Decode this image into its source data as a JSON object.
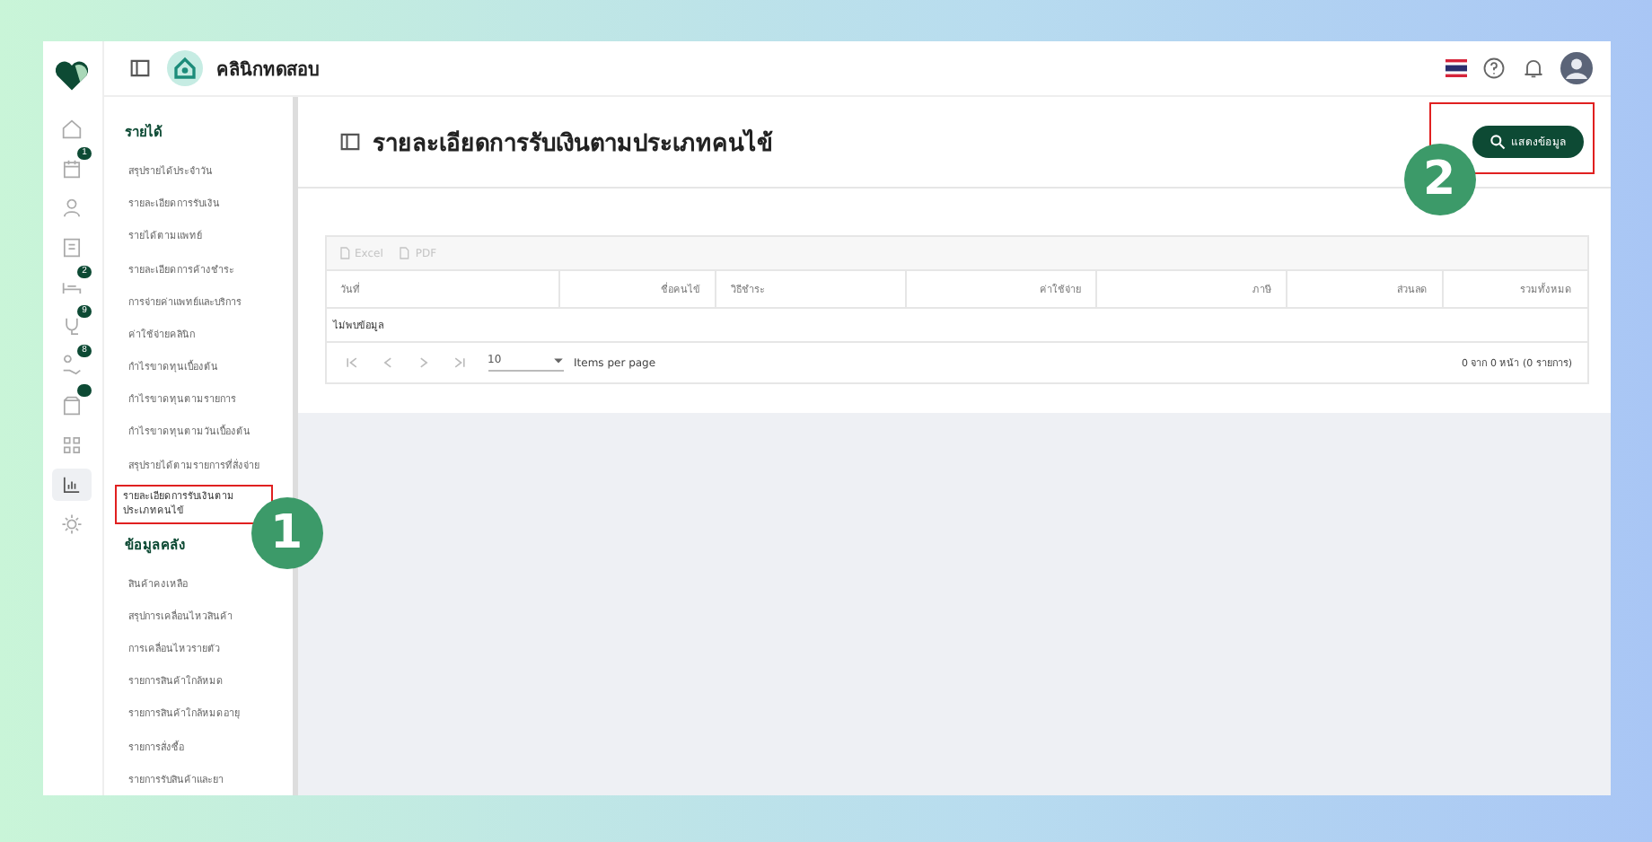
{
  "header": {
    "clinic_name": "คลินิกทดสอบ"
  },
  "rail": [
    {
      "selected": false
    },
    {
      "badge": "1",
      "selected": false
    },
    {
      "selected": false
    },
    {
      "selected": false
    },
    {
      "badge": "2",
      "selected": false
    },
    {
      "badge": "9",
      "selected": false
    },
    {
      "badge": "8",
      "selected": false
    },
    {
      "dot": true,
      "selected": false
    },
    {
      "selected": false
    },
    {
      "selected": true
    },
    {
      "selected": false
    }
  ],
  "menu": [
    {
      "kind": "heading",
      "label": "รายได้"
    },
    {
      "kind": "item",
      "label": "สรุปรายได้ประจำวัน",
      "selected": false
    },
    {
      "kind": "item",
      "label": "รายละเอียดการรับเงิน",
      "selected": false
    },
    {
      "kind": "item",
      "label": "รายได้ตามแพทย์",
      "selected": false
    },
    {
      "kind": "item",
      "label": "รายละเอียดการค้างชำระ",
      "selected": false
    },
    {
      "kind": "item",
      "label": "การจ่ายค่าแพทย์และบริการ",
      "selected": false
    },
    {
      "kind": "item",
      "label": "ค่าใช้จ่ายคลินิก",
      "selected": false
    },
    {
      "kind": "item",
      "label": "กำไรขาดทุนเบื้องต้น",
      "selected": false
    },
    {
      "kind": "item",
      "label": "กำไรขาดทุนตามรายการ",
      "selected": false
    },
    {
      "kind": "item",
      "label": "กำไรขาดทุนตามวันเบื้องต้น",
      "selected": false
    },
    {
      "kind": "item",
      "label": "สรุปรายได้ตามรายการที่สั่งจ่าย",
      "selected": false
    },
    {
      "kind": "item",
      "label": "รายละเอียดการรับเงินตามประเภทคนไข้",
      "selected": true
    },
    {
      "kind": "heading",
      "label": "ข้อมูลคลัง"
    },
    {
      "kind": "item",
      "label": "สินค้าคงเหลือ",
      "selected": false
    },
    {
      "kind": "item",
      "label": "สรุปการเคลื่อนไหวสินค้า",
      "selected": false
    },
    {
      "kind": "item",
      "label": "การเคลื่อนไหวรายตัว",
      "selected": false
    },
    {
      "kind": "item",
      "label": "รายการสินค้าใกล้หมด",
      "selected": false
    },
    {
      "kind": "item",
      "label": "รายการสินค้าใกล้หมดอายุ",
      "selected": false
    },
    {
      "kind": "item",
      "label": "รายการสั่งซื้อ",
      "selected": false
    },
    {
      "kind": "item",
      "label": "รายการรับสินค้าและยา",
      "selected": false
    }
  ],
  "page": {
    "title": "รายละเอียดการรับเงินตามประเภทคนไข้",
    "show_button": "แสดงข้อมูล"
  },
  "export": [
    {
      "label": "Excel",
      "disabled": true
    },
    {
      "label": "PDF",
      "disabled": true
    }
  ],
  "table": {
    "columns": [
      "วันที่",
      "ชื่อคนไข้",
      "วิธีชำระ",
      "ค่าใช้จ่าย",
      "ภาษี",
      "ส่วนลด",
      "รวมทั้งหมด"
    ],
    "empty": "ไม่พบข้อมูล",
    "page_size": "10",
    "items_per_page": "Items per page",
    "summary": "0 จาก 0 หน้า (0 รายการ)"
  },
  "callouts": [
    {
      "number": "1"
    },
    {
      "number": "2"
    }
  ]
}
